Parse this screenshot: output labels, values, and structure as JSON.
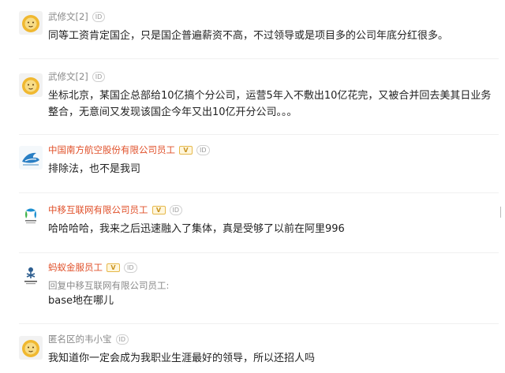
{
  "comments": [
    {
      "user": "武修文[2]",
      "id_badge": "ID",
      "text": "同等工资肯定国企，只是国企普遍薪资不高，不过领导或是项目多的公司年底分红很多。"
    },
    {
      "user": "武修文[2]",
      "id_badge": "ID",
      "text": "坐标北京，某国企总部给10亿搞个分公司，运营5年入不敷出10亿花完，又被合并回去美其日业务整合，无意间又发现该国企今年又出10亿开分公司。。。"
    },
    {
      "user": "中国南方航空股份有限公司员工",
      "v_badge": "V",
      "id_badge": "ID",
      "text": "排除法，也不是我司"
    },
    {
      "user": "中移互联网有限公司员工",
      "v_badge": "V",
      "id_badge": "ID",
      "text": "哈哈哈哈，我来之后迅速融入了集体，真是受够了以前在阿里996"
    },
    {
      "user": "蚂蚁金服员工",
      "v_badge": "V",
      "id_badge": "ID",
      "reply_to": "回复中移互联网有限公司员工:",
      "text": "base地在哪儿"
    },
    {
      "user": "匿名区的韦小宝",
      "id_badge": "ID",
      "text": "我知道你一定会成为我职业生涯最好的领导，所以还招人吗"
    }
  ],
  "colors": {
    "company_name": "#e0502a",
    "anon_name": "#8a8a8a",
    "v_badge": "#e6b84a"
  },
  "icons": [
    "lion-avatar-icon",
    "airline-logo-icon",
    "china-mobile-logo-icon",
    "ant-logo-icon"
  ]
}
